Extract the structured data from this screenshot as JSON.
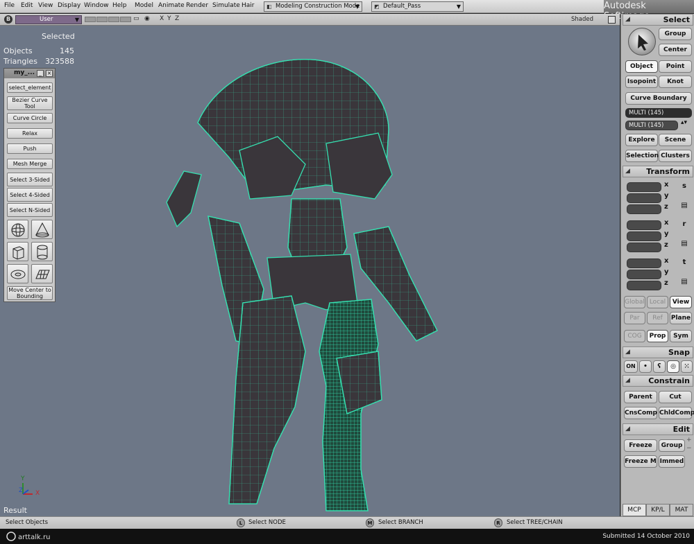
{
  "menubar": {
    "items": [
      "File",
      "Edit",
      "View",
      "Display",
      "Window",
      "Help",
      "Model",
      "Animate",
      "Render",
      "Simulate",
      "Hair"
    ],
    "mode_dropdown": "Modeling Construction Mode",
    "pass_dropdown": "Default_Pass",
    "brand": "Autodesk Softimage"
  },
  "viewport": {
    "button_b": "B",
    "camera": "User",
    "axis_labels": [
      "X",
      "Y",
      "Z"
    ],
    "display_mode": "Shaded",
    "selected_label": "Selected",
    "stats": [
      {
        "label": "Objects",
        "value": "145"
      },
      {
        "label": "Triangles",
        "value": "323588"
      }
    ],
    "result_label": "Result",
    "axis_indicator": {
      "y": "Y",
      "z": "Z",
      "x": "X"
    }
  },
  "toolbar": {
    "title": "my_...",
    "buttons": [
      "select_element",
      "Bezier Curve Tool",
      "Curve Circle",
      "Relax",
      "Push",
      "Mesh Merge",
      "Select 3-Sided",
      "Select 4-Sided",
      "Select N-Sided",
      "Move Center to Bounding"
    ],
    "primitive_icons": [
      "sphere-icon",
      "cone-icon",
      "cube-icon",
      "cylinder-icon",
      "torus-icon",
      "grid-icon"
    ]
  },
  "mcp": {
    "select": {
      "title": "Select",
      "group": "Group",
      "center": "Center",
      "object": "Object",
      "point": "Point",
      "isopoint": "Isopoint",
      "knot": "Knot",
      "curve_boundary": "Curve Boundary",
      "selection_field": "MULTI (145)",
      "selection_field2": "MULTI (145)",
      "explore": "Explore",
      "scene": "Scene",
      "selection": "Selection",
      "clusters": "Clusters"
    },
    "transform": {
      "title": "Transform",
      "axes": [
        "x",
        "y",
        "z"
      ],
      "scale_icon": "s",
      "rotate_icon": "r",
      "translate_icon": "t",
      "global": "Global",
      "local": "Local",
      "view": "View",
      "par": "Par",
      "ref": "Ref",
      "plane": "Plane",
      "cog": "COG",
      "prop": "Prop",
      "sym": "Sym"
    },
    "snap": {
      "title": "Snap",
      "on": "ON"
    },
    "constrain": {
      "title": "Constrain",
      "parent": "Parent",
      "cut": "Cut",
      "cnscomp": "CnsComp",
      "chldcomp": "ChldComp"
    },
    "edit": {
      "title": "Edit",
      "freeze": "Freeze",
      "group": "Group",
      "freeze_m": "Freeze M",
      "immed": "Immed"
    },
    "tabs": [
      "MCP",
      "KP/L",
      "MAT"
    ]
  },
  "statusbar": {
    "left": "Select Objects",
    "l_key": "L",
    "l_text": "Select NODE",
    "m_key": "M",
    "m_text": "Select BRANCH",
    "r_key": "R",
    "r_text": "Select TREE/CHAIN"
  },
  "footer": {
    "watermark": "arttalk.ru",
    "submitted": "Submitted 14 October 2010"
  },
  "colors": {
    "viewport_bg": "#6d7787",
    "wire_highlight": "#35e0b0",
    "model_body": "#3a363b",
    "camera_dropdown": "#7e6a8a"
  }
}
